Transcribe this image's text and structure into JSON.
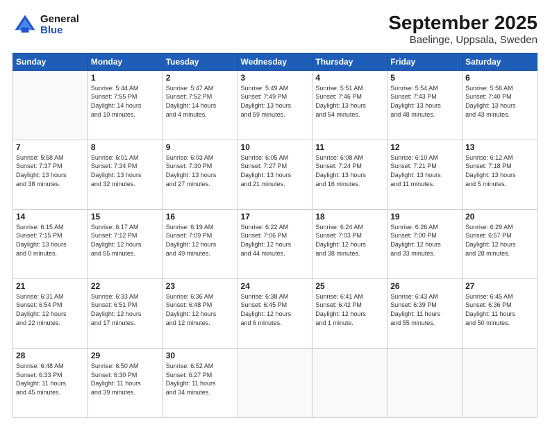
{
  "header": {
    "title": "September 2025",
    "subtitle": "Baelinge, Uppsala, Sweden",
    "logo_line1": "General",
    "logo_line2": "Blue"
  },
  "days_of_week": [
    "Sunday",
    "Monday",
    "Tuesday",
    "Wednesday",
    "Thursday",
    "Friday",
    "Saturday"
  ],
  "weeks": [
    [
      {
        "day": "",
        "info": ""
      },
      {
        "day": "1",
        "info": "Sunrise: 5:44 AM\nSunset: 7:55 PM\nDaylight: 14 hours\nand 10 minutes."
      },
      {
        "day": "2",
        "info": "Sunrise: 5:47 AM\nSunset: 7:52 PM\nDaylight: 14 hours\nand 4 minutes."
      },
      {
        "day": "3",
        "info": "Sunrise: 5:49 AM\nSunset: 7:49 PM\nDaylight: 13 hours\nand 59 minutes."
      },
      {
        "day": "4",
        "info": "Sunrise: 5:51 AM\nSunset: 7:46 PM\nDaylight: 13 hours\nand 54 minutes."
      },
      {
        "day": "5",
        "info": "Sunrise: 5:54 AM\nSunset: 7:43 PM\nDaylight: 13 hours\nand 48 minutes."
      },
      {
        "day": "6",
        "info": "Sunrise: 5:56 AM\nSunset: 7:40 PM\nDaylight: 13 hours\nand 43 minutes."
      }
    ],
    [
      {
        "day": "7",
        "info": "Sunrise: 5:58 AM\nSunset: 7:37 PM\nDaylight: 13 hours\nand 38 minutes."
      },
      {
        "day": "8",
        "info": "Sunrise: 6:01 AM\nSunset: 7:34 PM\nDaylight: 13 hours\nand 32 minutes."
      },
      {
        "day": "9",
        "info": "Sunrise: 6:03 AM\nSunset: 7:30 PM\nDaylight: 13 hours\nand 27 minutes."
      },
      {
        "day": "10",
        "info": "Sunrise: 6:05 AM\nSunset: 7:27 PM\nDaylight: 13 hours\nand 21 minutes."
      },
      {
        "day": "11",
        "info": "Sunrise: 6:08 AM\nSunset: 7:24 PM\nDaylight: 13 hours\nand 16 minutes."
      },
      {
        "day": "12",
        "info": "Sunrise: 6:10 AM\nSunset: 7:21 PM\nDaylight: 13 hours\nand 11 minutes."
      },
      {
        "day": "13",
        "info": "Sunrise: 6:12 AM\nSunset: 7:18 PM\nDaylight: 13 hours\nand 5 minutes."
      }
    ],
    [
      {
        "day": "14",
        "info": "Sunrise: 6:15 AM\nSunset: 7:15 PM\nDaylight: 13 hours\nand 0 minutes."
      },
      {
        "day": "15",
        "info": "Sunrise: 6:17 AM\nSunset: 7:12 PM\nDaylight: 12 hours\nand 55 minutes."
      },
      {
        "day": "16",
        "info": "Sunrise: 6:19 AM\nSunset: 7:09 PM\nDaylight: 12 hours\nand 49 minutes."
      },
      {
        "day": "17",
        "info": "Sunrise: 6:22 AM\nSunset: 7:06 PM\nDaylight: 12 hours\nand 44 minutes."
      },
      {
        "day": "18",
        "info": "Sunrise: 6:24 AM\nSunset: 7:03 PM\nDaylight: 12 hours\nand 38 minutes."
      },
      {
        "day": "19",
        "info": "Sunrise: 6:26 AM\nSunset: 7:00 PM\nDaylight: 12 hours\nand 33 minutes."
      },
      {
        "day": "20",
        "info": "Sunrise: 6:29 AM\nSunset: 6:57 PM\nDaylight: 12 hours\nand 28 minutes."
      }
    ],
    [
      {
        "day": "21",
        "info": "Sunrise: 6:31 AM\nSunset: 6:54 PM\nDaylight: 12 hours\nand 22 minutes."
      },
      {
        "day": "22",
        "info": "Sunrise: 6:33 AM\nSunset: 6:51 PM\nDaylight: 12 hours\nand 17 minutes."
      },
      {
        "day": "23",
        "info": "Sunrise: 6:36 AM\nSunset: 6:48 PM\nDaylight: 12 hours\nand 12 minutes."
      },
      {
        "day": "24",
        "info": "Sunrise: 6:38 AM\nSunset: 6:45 PM\nDaylight: 12 hours\nand 6 minutes."
      },
      {
        "day": "25",
        "info": "Sunrise: 6:41 AM\nSunset: 6:42 PM\nDaylight: 12 hours\nand 1 minute."
      },
      {
        "day": "26",
        "info": "Sunrise: 6:43 AM\nSunset: 6:39 PM\nDaylight: 11 hours\nand 55 minutes."
      },
      {
        "day": "27",
        "info": "Sunrise: 6:45 AM\nSunset: 6:36 PM\nDaylight: 11 hours\nand 50 minutes."
      }
    ],
    [
      {
        "day": "28",
        "info": "Sunrise: 6:48 AM\nSunset: 6:33 PM\nDaylight: 11 hours\nand 45 minutes."
      },
      {
        "day": "29",
        "info": "Sunrise: 6:50 AM\nSunset: 6:30 PM\nDaylight: 11 hours\nand 39 minutes."
      },
      {
        "day": "30",
        "info": "Sunrise: 6:52 AM\nSunset: 6:27 PM\nDaylight: 11 hours\nand 34 minutes."
      },
      {
        "day": "",
        "info": ""
      },
      {
        "day": "",
        "info": ""
      },
      {
        "day": "",
        "info": ""
      },
      {
        "day": "",
        "info": ""
      }
    ]
  ]
}
